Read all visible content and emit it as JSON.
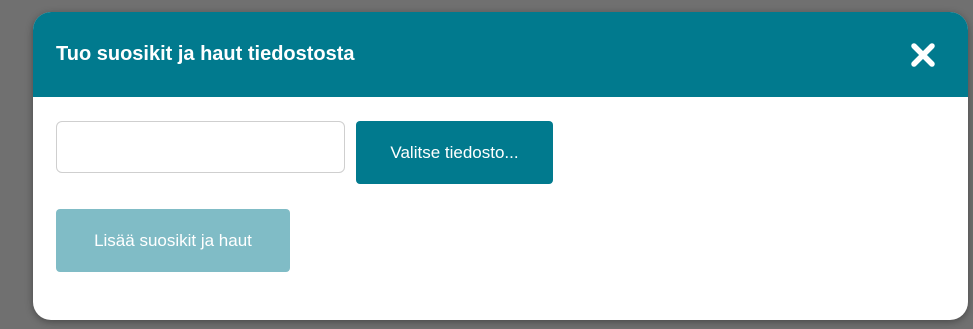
{
  "dialog": {
    "title": "Tuo suosikit ja haut tiedostosta",
    "close_icon": "close-icon",
    "file_input": {
      "value": "",
      "placeholder": ""
    },
    "choose_button_label": "Valitse tiedosto...",
    "add_button_label": "Lisää suosikit ja haut",
    "add_button_state": "disabled"
  },
  "colors": {
    "header": "#017a8e",
    "primary_button": "#017a8e",
    "disabled_button": "#80bcc6",
    "backdrop": "#707070"
  }
}
